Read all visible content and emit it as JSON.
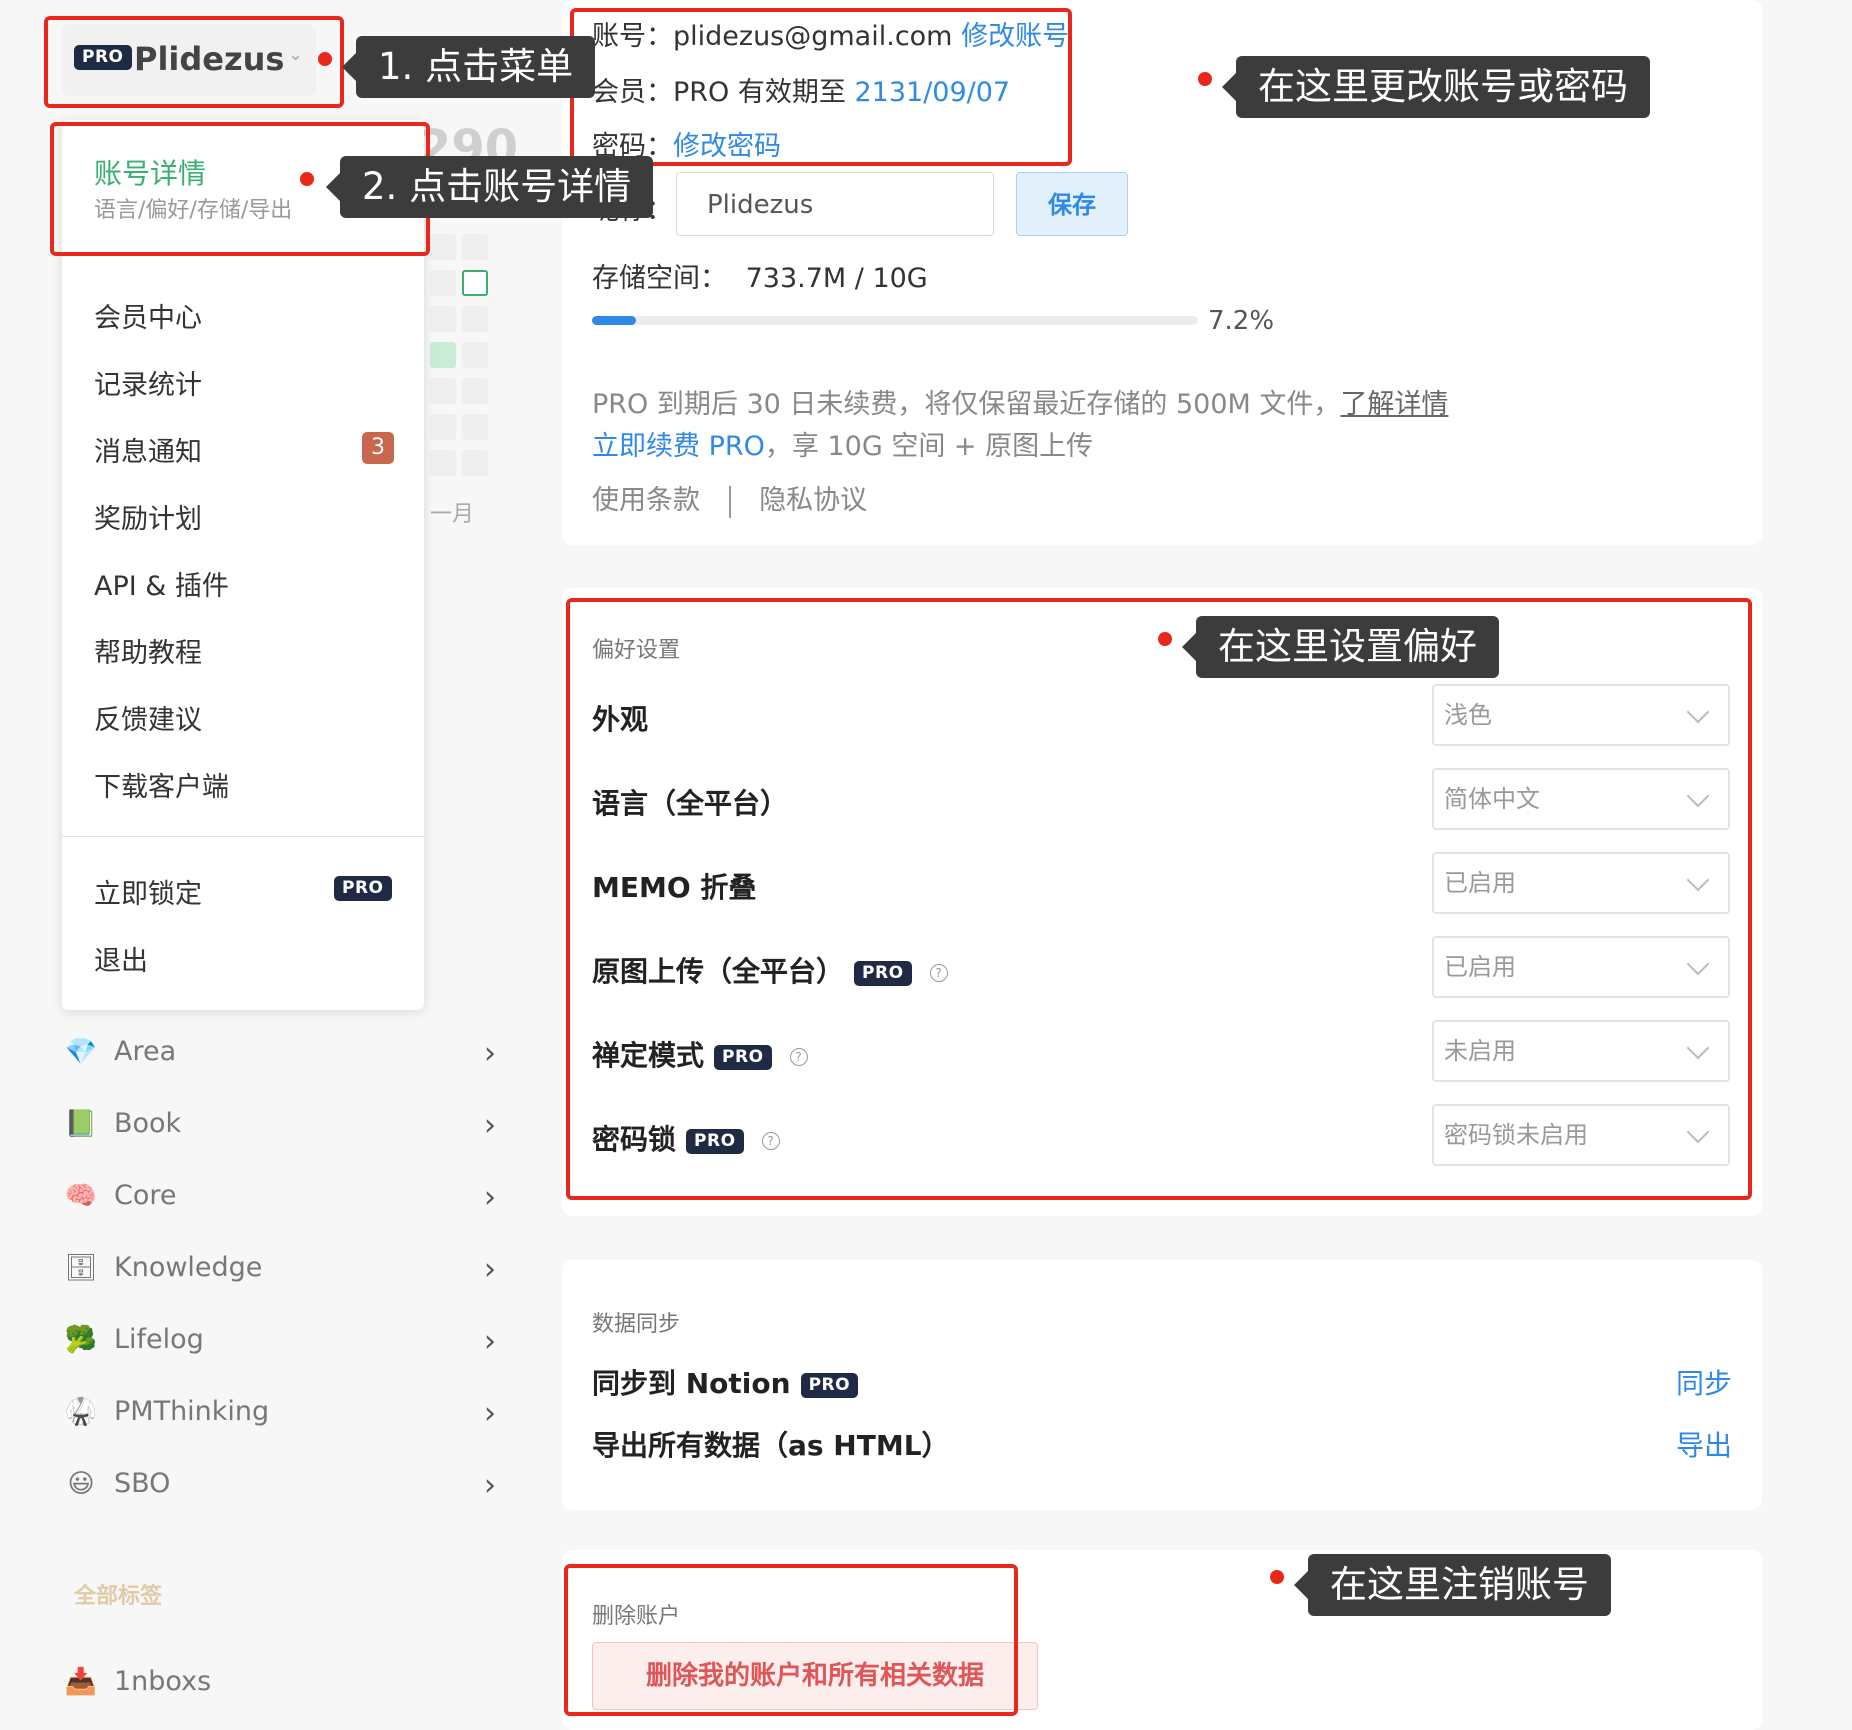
{
  "menu": {
    "pro_badge": "PRO",
    "username": "Plidezus",
    "chevron": "chevron-down-icon"
  },
  "dropdown": {
    "account_title": "账号详情",
    "account_subtitle": "语言/偏好/存储/导出",
    "items": [
      {
        "label": "会员中心"
      },
      {
        "label": "记录统计"
      },
      {
        "label": "消息通知",
        "badge": "3"
      },
      {
        "label": "奖励计划"
      },
      {
        "label": "API & 插件"
      },
      {
        "label": "帮助教程"
      },
      {
        "label": "反馈建议"
      },
      {
        "label": "下载客户端"
      }
    ],
    "lock_label": "立即锁定",
    "lock_badge": "PRO",
    "logout_label": "退出"
  },
  "sidebar": {
    "partial_number": "290",
    "partial_month": "一月",
    "items": [
      {
        "label": "Area",
        "icon": "💎"
      },
      {
        "label": "Book",
        "icon": "📗"
      },
      {
        "label": "Core",
        "icon": "🧠"
      },
      {
        "label": "Knowledge",
        "icon": "🗄"
      },
      {
        "label": "Lifelog",
        "icon": "🥦"
      },
      {
        "label": "PMThinking",
        "icon": "🥋"
      },
      {
        "label": "SBO",
        "icon": "😃"
      }
    ],
    "all_tags_label": "全部标签",
    "inbox_label": "1nboxs",
    "inbox_icon": "📥"
  },
  "account": {
    "account_label": "账号：",
    "email": "plidezus@gmail.com",
    "edit_account": "修改账号",
    "member_label": "会员：",
    "member_value": "PRO 有效期至",
    "member_date": "2131/09/07",
    "password_label": "密码：",
    "edit_password": "修改密码",
    "nickname_label": "昵称：",
    "nickname_value": "Plidezus",
    "save_label": "保存",
    "storage_label": "存储空间：",
    "storage_value": "733.7M / 10G",
    "storage_percent": "7.2%",
    "storage_fraction": 0.072,
    "notice_text": "PRO 到期后 30 日未续费，将仅保留最近存储的 500M 文件，",
    "notice_link": "了解详情",
    "renew_link": "立即续费 PRO",
    "renew_text": "，享 10G 空间 + 原图上传",
    "terms_label": "使用条款",
    "privacy_label": "隐私协议"
  },
  "preferences": {
    "title": "偏好设置",
    "rows": [
      {
        "label": "外观",
        "value": "浅色"
      },
      {
        "label": "语言（全平台）",
        "value": "简体中文"
      },
      {
        "label": "MEMO 折叠",
        "value": "已启用"
      },
      {
        "label": "原图上传（全平台）",
        "value": "已启用",
        "pro": "PRO"
      },
      {
        "label": "禅定模式",
        "value": "未启用",
        "pro": "PRO"
      },
      {
        "label": "密码锁",
        "value": "密码锁未启用",
        "pro": "PRO"
      }
    ]
  },
  "sync": {
    "title": "数据同步",
    "notion_label": "同步到 Notion",
    "notion_badge": "PRO",
    "notion_action": "同步",
    "export_label": "导出所有数据（as HTML）",
    "export_action": "导出"
  },
  "delete": {
    "title": "删除账户",
    "button_label": "删除我的账户和所有相关数据"
  },
  "annotations": {
    "step1": "1. 点击菜单",
    "step2": "2. 点击账号详情",
    "account_hint": "在这里更改账号或密码",
    "pref_hint": "在这里设置偏好",
    "delete_hint": "在这里注销账号"
  },
  "colors": {
    "accent": "#2e8ae6",
    "annotation_red": "#e8281c",
    "callout_bg": "#3c3c3c",
    "pro_badge": "#1f2a44",
    "green_active": "#3ab070"
  }
}
